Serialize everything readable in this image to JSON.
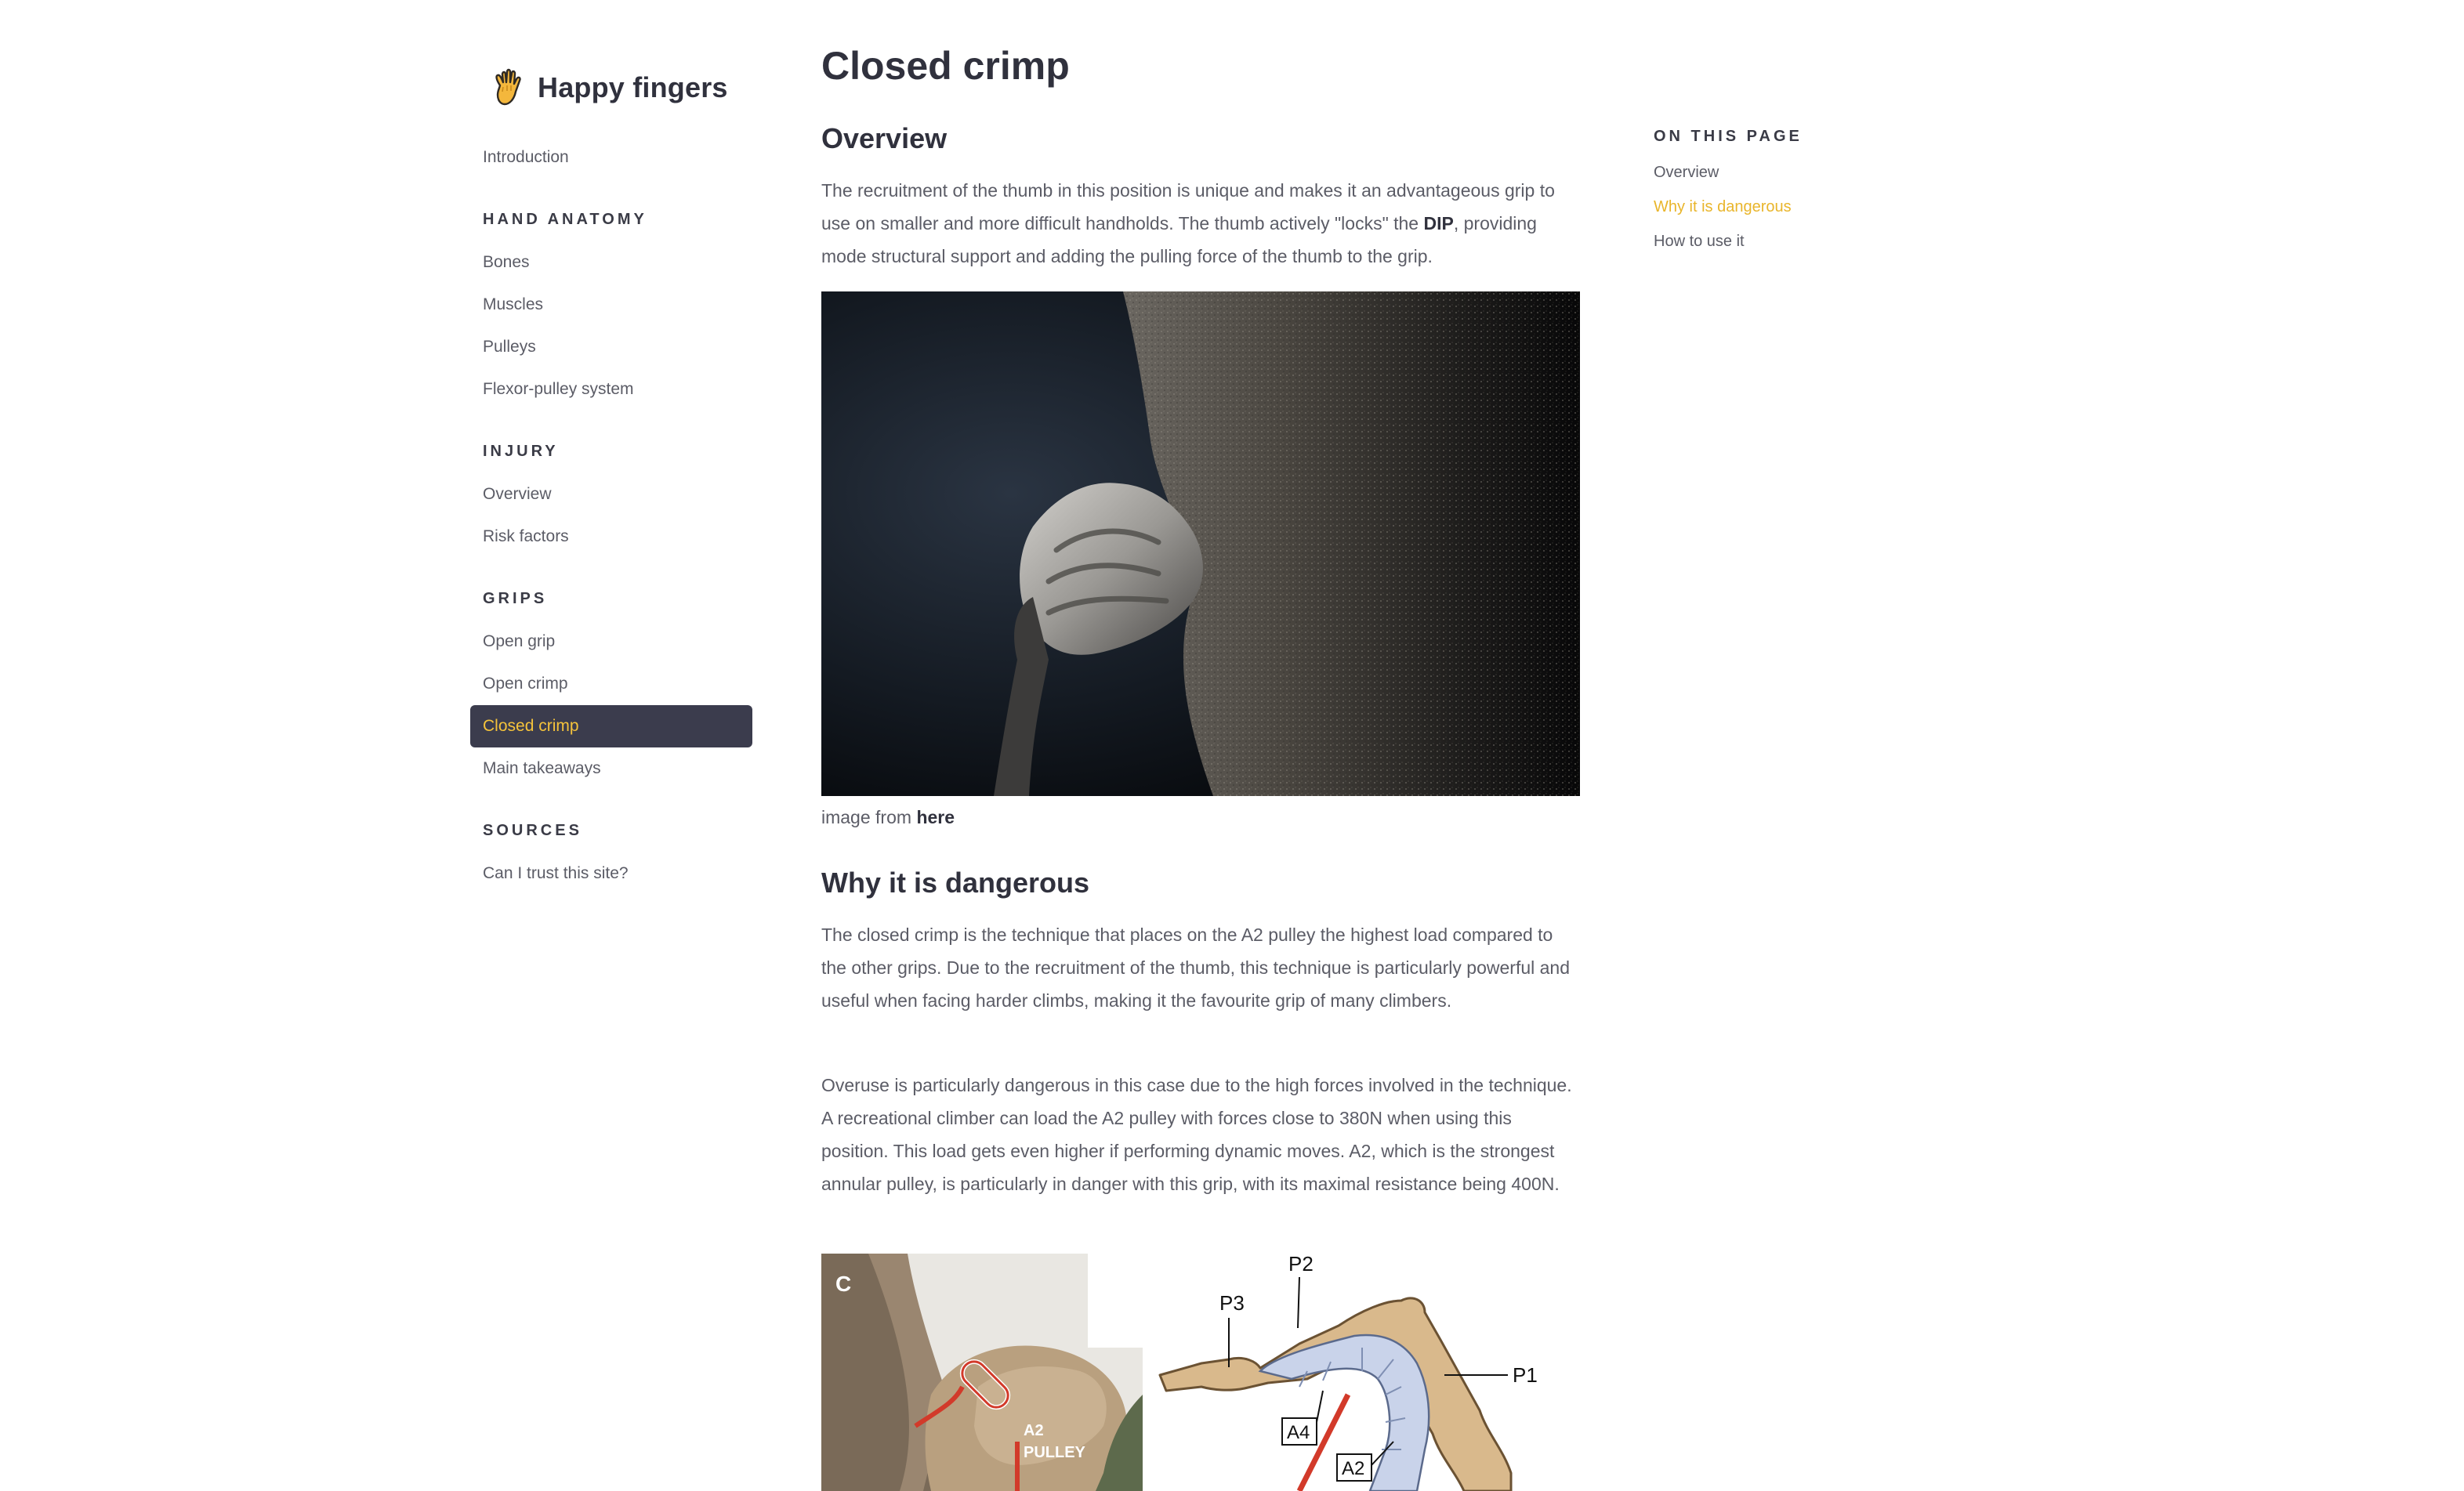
{
  "sidebar": {
    "brand_icon": "hand-icon",
    "brand_title": "Happy fingers",
    "intro": "Introduction",
    "sections": [
      {
        "title": "HAND ANATOMY",
        "items": [
          "Bones",
          "Muscles",
          "Pulleys",
          "Flexor-pulley system"
        ]
      },
      {
        "title": "INJURY",
        "items": [
          "Overview",
          "Risk factors"
        ]
      },
      {
        "title": "GRIPS",
        "items": [
          "Open grip",
          "Open crimp",
          "Closed crimp",
          "Main takeaways"
        ]
      },
      {
        "title": "SOURCES",
        "items": [
          "Can I trust this site?"
        ]
      }
    ],
    "active_item": "Closed crimp",
    "active_bg": "#3b3c4d",
    "active_color": "#f5c33b"
  },
  "main": {
    "title": "Closed crimp",
    "overview_heading": "Overview",
    "overview_text_1": "The recruitment of the thumb in this position is unique and makes it an advantageous grip to use on smaller and more difficult handholds. The thumb actively \"locks\" the ",
    "overview_bold": "DIP",
    "overview_text_2": ", providing mode structural support and adding the pulling force of the thumb to the grip.",
    "caption_prefix": "image from ",
    "caption_link": "here",
    "danger_heading": "Why it is dangerous",
    "danger_p1": "The closed crimp is the technique that places on the A2 pulley the highest load compared to the other grips. Due to the recruitment of the thumb, this technique is particularly powerful and useful when facing harder climbs, making it the favourite grip of many climbers.",
    "danger_p2": "Overuse is particularly dangerous in this case due to the high forces involved in the technique. A recreational climber can load the A2 pulley with forces close to 380N when using this position. This load gets even higher if performing dynamic moves. A2, which is the strongest annular pulley, is particularly in danger with this grip, with its maximal resistance being 400N.",
    "figure": {
      "panel_letter": "C",
      "pulley_label_1": "A2",
      "pulley_label_2": "PULLEY",
      "bone_labels": [
        "P3",
        "P2",
        "P1"
      ],
      "box_labels": [
        "A4",
        "A2"
      ]
    }
  },
  "toc": {
    "title": "ON THIS PAGE",
    "items": [
      "Overview",
      "Why it is dangerous",
      "How to use it"
    ],
    "active_item": "Why it is dangerous",
    "active_color": "#e9b52b"
  }
}
